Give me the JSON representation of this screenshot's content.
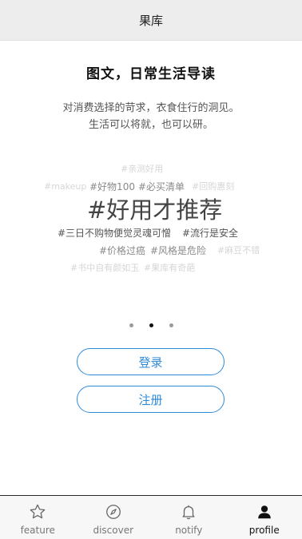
{
  "header": {
    "title": "果库"
  },
  "intro": {
    "headline": "图文，日常生活导读",
    "line1": "对消费选择的苛求，衣食住行的洞见。",
    "line2": "生活可以将就，也可以研。"
  },
  "tags": {
    "row1": "#亲测好用",
    "row2_a": "#makeup",
    "row2_b": "#好物100",
    "row2_c": "#必买清单",
    "row2_d": "#回购惠刻",
    "big": "#好用才推荐",
    "row4_a": "#三日不购物便觉灵魂可憎",
    "row4_b": "#流行是安全",
    "row5_a": "#价格过癌",
    "row5_b": "#风格是危险",
    "row5_c": "#麻豆不错",
    "row6_a": "#书中自有颜如玉",
    "row6_b": "#果库有奇葩"
  },
  "carousel": {
    "pages": 3,
    "active_index": 1
  },
  "buttons": {
    "login": "登录",
    "register": "注册"
  },
  "colors": {
    "accent": "#2f8ad8",
    "header_bg": "#ededed",
    "tabbar_bg": "#f7f7f7"
  },
  "tabbar": {
    "items": [
      {
        "label": "feature",
        "icon": "star-icon"
      },
      {
        "label": "discover",
        "icon": "compass-icon"
      },
      {
        "label": "notify",
        "icon": "bell-icon"
      },
      {
        "label": "profile",
        "icon": "user-icon"
      }
    ],
    "active": "profile"
  }
}
